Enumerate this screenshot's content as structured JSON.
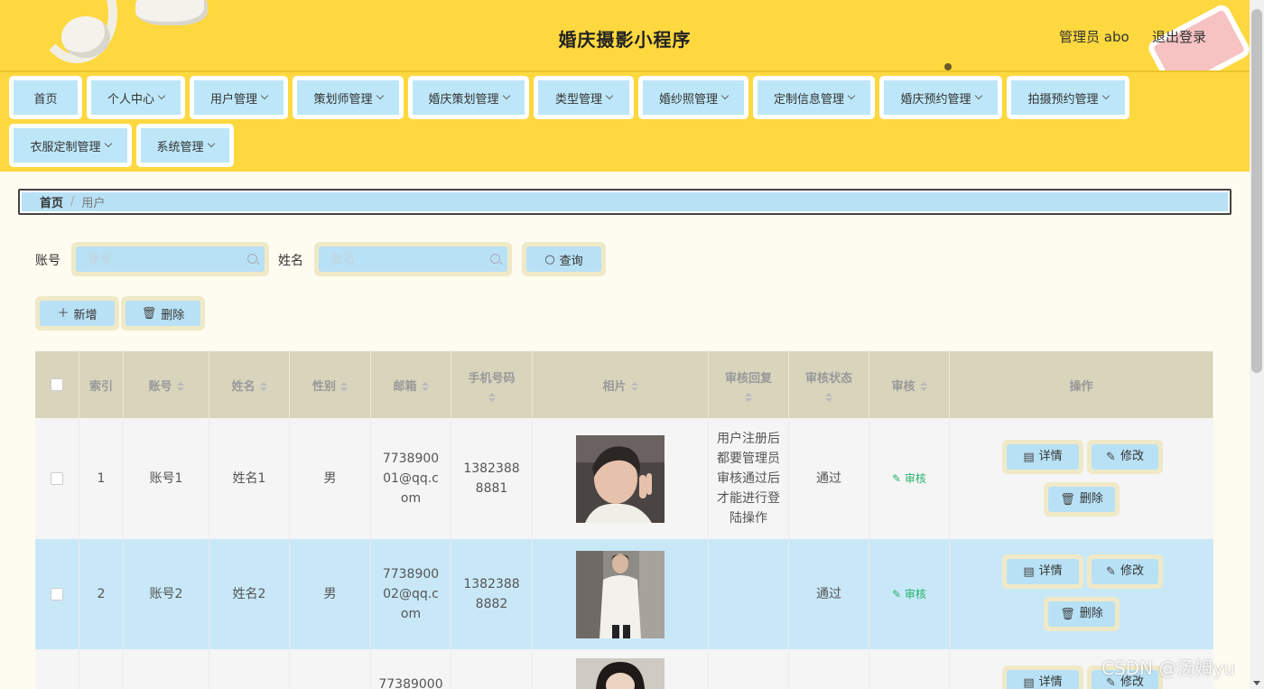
{
  "header": {
    "title": "婚庆摄影小程序",
    "user_label": "管理员 abo",
    "logout_label": "退出登录"
  },
  "nav": {
    "items": [
      {
        "label": "首页",
        "dropdown": false
      },
      {
        "label": "个人中心",
        "dropdown": true
      },
      {
        "label": "用户管理",
        "dropdown": true
      },
      {
        "label": "策划师管理",
        "dropdown": true
      },
      {
        "label": "婚庆策划管理",
        "dropdown": true
      },
      {
        "label": "类型管理",
        "dropdown": true
      },
      {
        "label": "婚纱照管理",
        "dropdown": true
      },
      {
        "label": "定制信息管理",
        "dropdown": true
      },
      {
        "label": "婚庆预约管理",
        "dropdown": true
      },
      {
        "label": "拍摄预约管理",
        "dropdown": true
      },
      {
        "label": "衣服定制管理",
        "dropdown": true
      },
      {
        "label": "系统管理",
        "dropdown": true
      }
    ]
  },
  "breadcrumb": {
    "home": "首页",
    "separator": "/",
    "current": "用户"
  },
  "search": {
    "account_label": "账号",
    "account_placeholder": "账号",
    "name_label": "姓名",
    "name_placeholder": "姓名",
    "query_button": "查询",
    "query_icon": "search-icon"
  },
  "actions": {
    "add_button": "新增",
    "add_icon": "plus-icon",
    "delete_button": "删除",
    "delete_icon": "trash-icon"
  },
  "table": {
    "columns": [
      "索引",
      "账号",
      "姓名",
      "性别",
      "邮箱",
      "手机号码",
      "相片",
      "审核回复",
      "审核状态",
      "审核",
      "操作"
    ],
    "rows": [
      {
        "index": "1",
        "account": "账号1",
        "name": "姓名1",
        "gender": "男",
        "email": "773890001@qq.com",
        "phone": "13823888881",
        "reply": "用户注册后都要管理员审核通过后才能进行登陆操作",
        "status": "通过",
        "audit": "审核"
      },
      {
        "index": "2",
        "account": "账号2",
        "name": "姓名2",
        "gender": "男",
        "email": "773890002@qq.com",
        "phone": "13823888882",
        "reply": "",
        "status": "通过",
        "audit": "审核"
      },
      {
        "index": "",
        "account": "",
        "name": "",
        "gender": "",
        "email": "77389000",
        "phone": "",
        "reply": "",
        "status": "",
        "audit": ""
      }
    ],
    "op_labels": {
      "detail": "详情",
      "edit": "修改",
      "delete": "删除"
    }
  },
  "watermark": "CSDN @汤姆yu",
  "colors": {
    "header_bg": "#fdd83f",
    "nav_btn": "#bde7f9",
    "page_bg": "#fefbf0",
    "row_highlight": "#c8e8f8",
    "audit_green": "#26b36c"
  }
}
